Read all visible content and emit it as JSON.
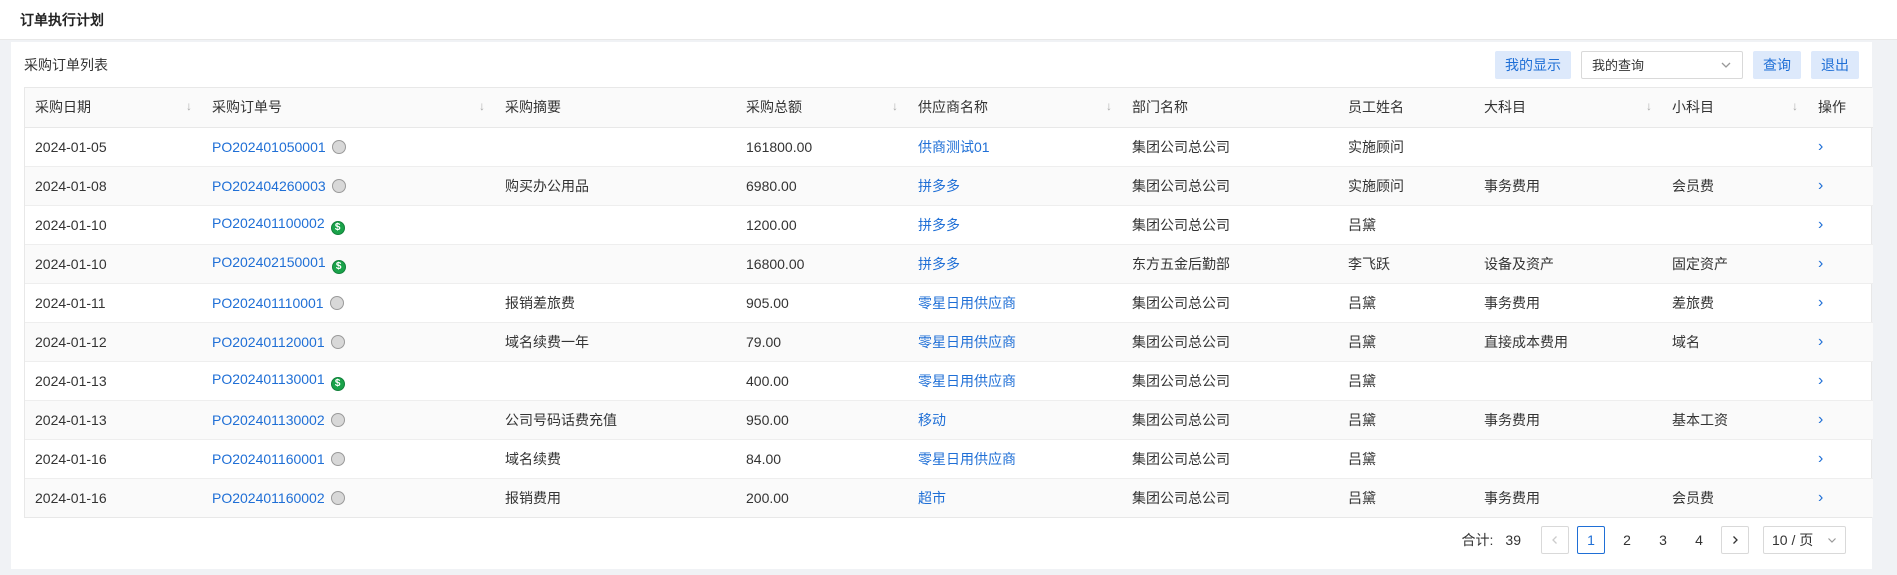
{
  "page": {
    "title": "订单执行计划"
  },
  "panel": {
    "title": "采购订单列表"
  },
  "toolbar": {
    "my_display_label": "我的显示",
    "query_select_value": "我的查询",
    "search_label": "查询",
    "exit_label": "退出"
  },
  "columns": [
    "采购日期",
    "采购订单号",
    "采购摘要",
    "采购总额",
    "供应商名称",
    "部门名称",
    "员工姓名",
    "大科目",
    "小科目",
    "操作"
  ],
  "rows": [
    {
      "date": "2024-01-05",
      "po": "PO202401050001",
      "status": "gray",
      "summary": "",
      "amount": "161800.00",
      "supplier": "供商测试01",
      "dept": "集团公司总公司",
      "employee": "实施顾问",
      "major": "",
      "minor": ""
    },
    {
      "date": "2024-01-08",
      "po": "PO202404260003",
      "status": "gray",
      "summary": "购买办公用品",
      "amount": "6980.00",
      "supplier": "拼多多",
      "dept": "集团公司总公司",
      "employee": "实施顾问",
      "major": "事务费用",
      "minor": "会员费"
    },
    {
      "date": "2024-01-10",
      "po": "PO202401100002",
      "status": "money",
      "summary": "",
      "amount": "1200.00",
      "supplier": "拼多多",
      "dept": "集团公司总公司",
      "employee": "吕黛",
      "major": "",
      "minor": ""
    },
    {
      "date": "2024-01-10",
      "po": "PO202402150001",
      "status": "money",
      "summary": "",
      "amount": "16800.00",
      "supplier": "拼多多",
      "dept": "东方五金后勤部",
      "employee": "李飞跃",
      "major": "设备及资产",
      "minor": "固定资产"
    },
    {
      "date": "2024-01-11",
      "po": "PO202401110001",
      "status": "gray",
      "summary": "报销差旅费",
      "amount": "905.00",
      "supplier": "零星日用供应商",
      "dept": "集团公司总公司",
      "employee": "吕黛",
      "major": "事务费用",
      "minor": "差旅费"
    },
    {
      "date": "2024-01-12",
      "po": "PO202401120001",
      "status": "gray",
      "summary": "域名续费一年",
      "amount": "79.00",
      "supplier": "零星日用供应商",
      "dept": "集团公司总公司",
      "employee": "吕黛",
      "major": "直接成本费用",
      "minor": "域名"
    },
    {
      "date": "2024-01-13",
      "po": "PO202401130001",
      "status": "money",
      "summary": "",
      "amount": "400.00",
      "supplier": "零星日用供应商",
      "dept": "集团公司总公司",
      "employee": "吕黛",
      "major": "",
      "minor": ""
    },
    {
      "date": "2024-01-13",
      "po": "PO202401130002",
      "status": "gray",
      "summary": "公司号码话费充值",
      "amount": "950.00",
      "supplier": "移动",
      "dept": "集团公司总公司",
      "employee": "吕黛",
      "major": "事务费用",
      "minor": "基本工资"
    },
    {
      "date": "2024-01-16",
      "po": "PO202401160001",
      "status": "gray",
      "summary": "域名续费",
      "amount": "84.00",
      "supplier": "零星日用供应商",
      "dept": "集团公司总公司",
      "employee": "吕黛",
      "major": "",
      "minor": ""
    },
    {
      "date": "2024-01-16",
      "po": "PO202401160002",
      "status": "gray",
      "summary": "报销费用",
      "amount": "200.00",
      "supplier": "超市",
      "dept": "集团公司总公司",
      "employee": "吕黛",
      "major": "事务费用",
      "minor": "会员费"
    }
  ],
  "pagination": {
    "total_label": "合计:",
    "total": "39",
    "pages": [
      "1",
      "2",
      "3",
      "4"
    ],
    "current": "1",
    "page_size": "10 / 页"
  },
  "colors": {
    "accent": "#1f6fd6",
    "button_bg": "#dde9fb",
    "money_icon": "#1aa34a"
  }
}
